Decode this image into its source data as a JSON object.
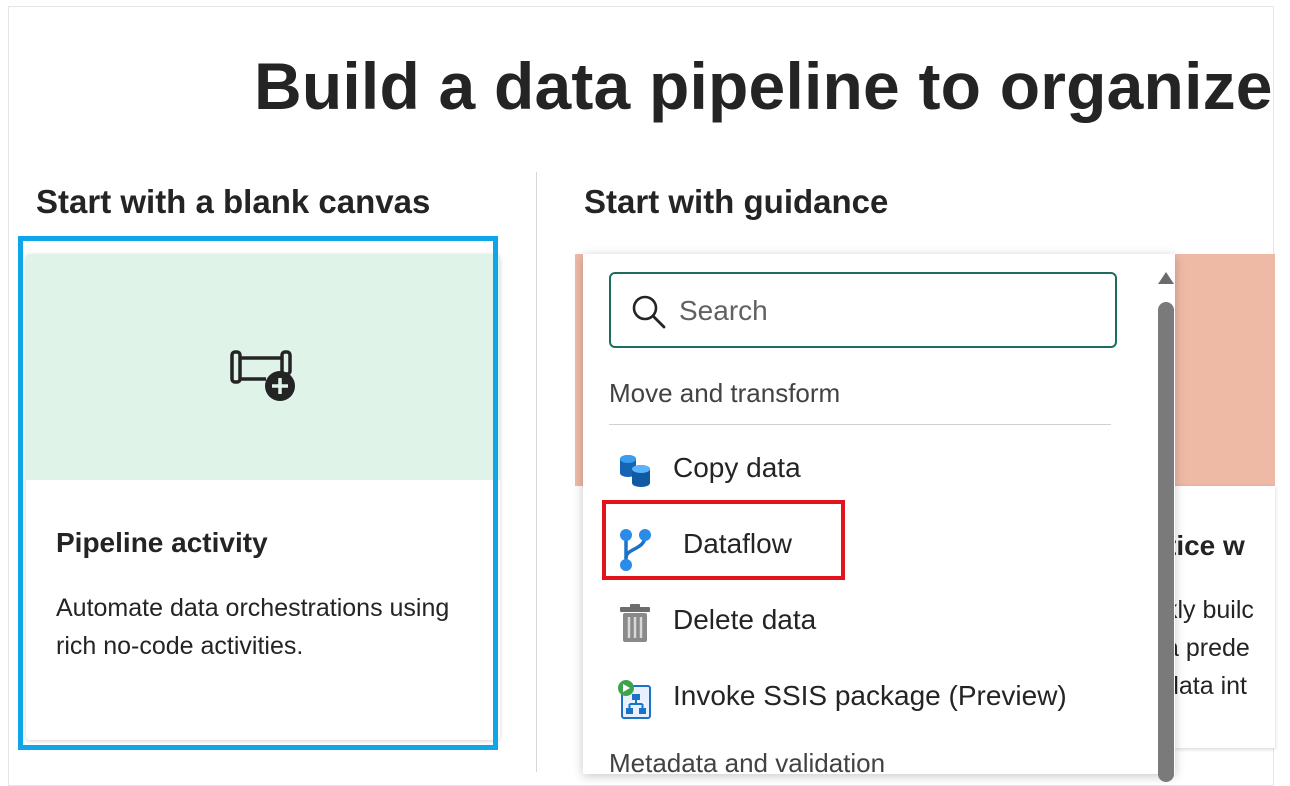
{
  "headline": "Build a data pipeline to organize a",
  "blank_canvas": {
    "section_title": "Start with a blank canvas",
    "card": {
      "icon": "pipeline-add-icon",
      "title": "Pipeline activity",
      "description": "Automate data orchestrations using rich no-code activities."
    }
  },
  "guidance": {
    "section_title": "Start with guidance",
    "search": {
      "placeholder": "Search",
      "value": ""
    },
    "groups": [
      {
        "label": "Move and transform",
        "items": [
          {
            "label": "Copy data",
            "icon": "copy-data-icon"
          },
          {
            "label": "Dataflow",
            "icon": "dataflow-icon"
          },
          {
            "label": "Delete data",
            "icon": "trash-icon"
          },
          {
            "label": "Invoke SSIS package (Preview)",
            "icon": "ssis-package-icon"
          }
        ]
      },
      {
        "label": "Metadata and validation"
      }
    ],
    "partial_card": {
      "title": "tice w",
      "description": "kly builc\na prede\ndata int"
    }
  },
  "colors": {
    "selected_outline": "#0ea5e9",
    "hero_background": "#dff3e9",
    "guidance_hero": "#efbaa5",
    "search_border": "#1e6b60",
    "highlight": "#e3131d"
  }
}
